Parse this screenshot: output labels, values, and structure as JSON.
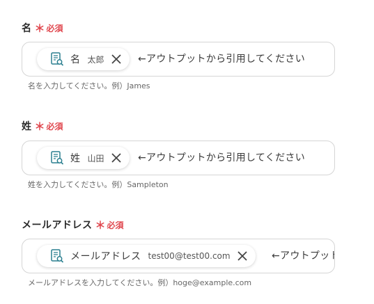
{
  "fields": [
    {
      "label": "名",
      "required_mark": "＊",
      "required_text": "必須",
      "chip_label": "名",
      "chip_value": "太郎",
      "inline_hint": "←アウトプットから引用してください",
      "help": "名を入力してください。例）James"
    },
    {
      "label": "姓",
      "required_mark": "＊",
      "required_text": "必須",
      "chip_label": "姓",
      "chip_value": "山田",
      "inline_hint": "←アウトプットから引用してください",
      "help": "姓を入力してください。例）Sampleton"
    },
    {
      "label": "メールアドレス",
      "required_mark": "＊",
      "required_text": "必須",
      "chip_label": "メールアドレス",
      "chip_value": "test00@test00.com",
      "inline_hint": "←アウトプットから引用してください",
      "help": "メールアドレスを入力してください。例）hoge@example.com"
    }
  ],
  "icons": {
    "chip_icon": "document-search-icon",
    "remove_icon": "close-icon"
  },
  "colors": {
    "required": "#e0484f",
    "border": "#d5d5d5",
    "icon_teal": "#2a7f8f"
  }
}
